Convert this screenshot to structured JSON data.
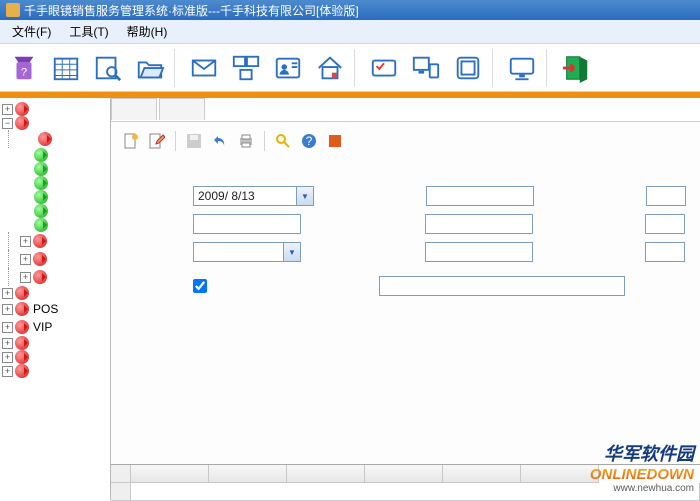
{
  "title": "千手眼镜销售服务管理系统·标准版---千手科技有限公司[体验版]",
  "menu": {
    "file": "文件(F)",
    "tool": "工具(T)",
    "help": "帮助(H)"
  },
  "toolbar": {
    "help": "帮助",
    "calendar": "日历",
    "search": "查询",
    "folder": "文件夹",
    "mail": "消息",
    "taskmix": "任务",
    "idcard": "名片",
    "home": "主页",
    "card": "卡",
    "pcphone": "终端",
    "card2": "卡片",
    "tv": "显示",
    "exit": "退出"
  },
  "editor_tools": {
    "new": "新建",
    "edit": "编辑",
    "save": "保存",
    "undo": "撤销",
    "print": "打印",
    "find": "查找",
    "help2": "帮助",
    "stop": "停止"
  },
  "form": {
    "date": "2009/ 8/13",
    "checkbox_state": "checked"
  },
  "tree": {
    "items": [
      {
        "label": "POS"
      },
      {
        "label": "VIP"
      }
    ]
  },
  "watermark": {
    "chinese": "华军软件园",
    "english": "ONLINEDOWN",
    "url": "www.newhua.com"
  }
}
